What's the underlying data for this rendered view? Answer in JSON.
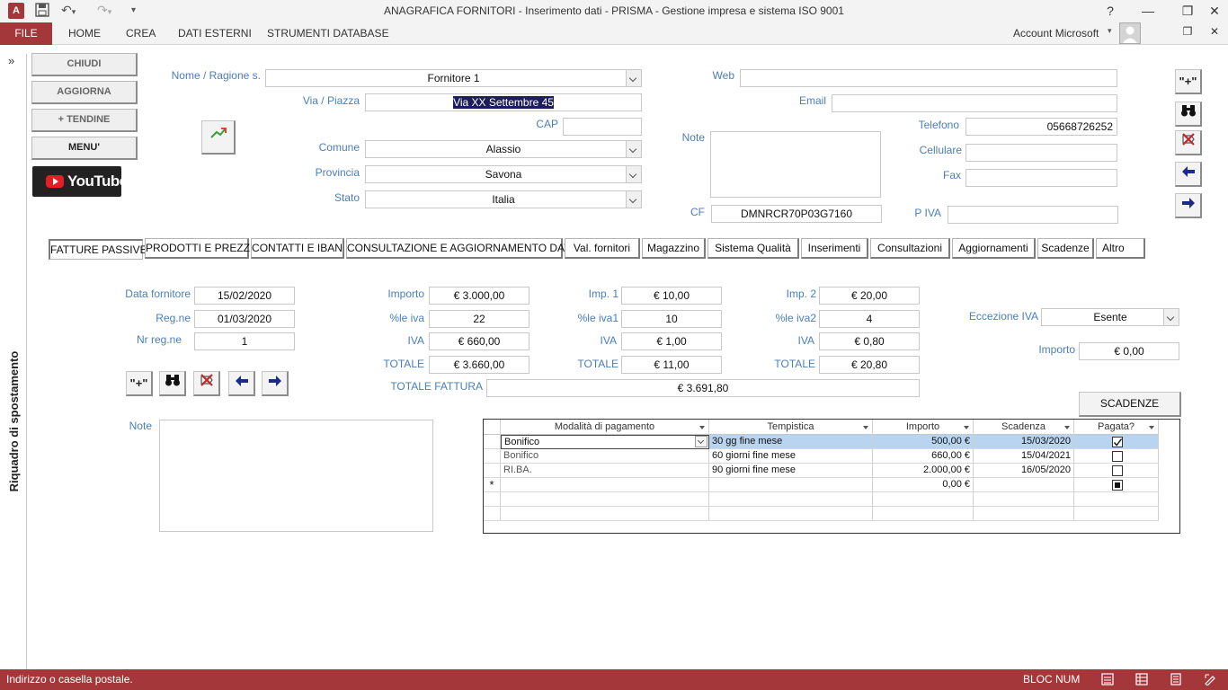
{
  "window": {
    "title": "ANAGRAFICA FORNITORI - Inserimento dati - PRISMA - Gestione impresa e sistema ISO 9001",
    "help": "?",
    "account": "Account Microsoft"
  },
  "ribbon": {
    "tabs": [
      "FILE",
      "HOME",
      "CREA",
      "DATI ESTERNI",
      "STRUMENTI DATABASE"
    ]
  },
  "navpane": {
    "title": "Riquadro di spostamento",
    "toggle": "»"
  },
  "left_buttons": {
    "chiudi": "CHIUDI",
    "aggiorna": "AGGIORNA",
    "tendine": "+ TENDINE",
    "menu": "MENU'",
    "youtube": "YouTube"
  },
  "header": {
    "nome_label": "Nome / Ragione s.",
    "nome": "Fornitore 1",
    "via_label": "Via / Piazza",
    "via": "Via XX Settembre 45",
    "cap_label": "CAP",
    "cap": "",
    "comune_label": "Comune",
    "comune": "Alassio",
    "provincia_label": "Provincia",
    "provincia": "Savona",
    "stato_label": "Stato",
    "stato": "Italia",
    "note_label": "Note",
    "note": "",
    "cf_label": "CF",
    "cf": "DMNRCR70P03G7160",
    "web_label": "Web",
    "web": "",
    "email_label": "Email",
    "email": "",
    "telefono_label": "Telefono",
    "telefono": "05668726252",
    "cellulare_label": "Cellulare",
    "cellulare": "",
    "fax_label": "Fax",
    "fax": "",
    "piva_label": "P IVA",
    "piva": ""
  },
  "tabs": [
    "FATTURE PASSIVE",
    "PRODOTTI E PREZZI",
    "CONTATTI E IBAN",
    "CONSULTAZIONE E AGGIORNAMENTO DATI",
    "Val. fornitori",
    "Magazzino",
    "Sistema Qualità",
    "Inserimenti",
    "Consultazioni",
    "Aggiornamenti",
    "Scadenze",
    "Altro"
  ],
  "invoice": {
    "data_fornitore_label": "Data fornitore",
    "data_fornitore": "15/02/2020",
    "regne_label": "Reg.ne",
    "regne": "01/03/2020",
    "nr_regne_label": "Nr reg.ne",
    "nr_regne": "1",
    "importo_label": "Importo",
    "importo": "€ 3.000,00",
    "perc_iva_label": "%le iva",
    "perc_iva": "22",
    "iva_label": "IVA",
    "iva": "€ 660,00",
    "totale_label": "TOTALE",
    "totale": "€ 3.660,00",
    "imp1_label": "Imp. 1",
    "imp1": "€ 10,00",
    "perc_iva1_label": "%le iva1",
    "perc_iva1": "10",
    "iva1_label": "IVA",
    "iva1": "€ 1,00",
    "totale1_label": "TOTALE",
    "totale1": "€ 11,00",
    "imp2_label": "Imp. 2",
    "imp2": "€ 20,00",
    "perc_iva2_label": "%le iva2",
    "perc_iva2": "4",
    "iva2_label": "IVA",
    "iva2": "€ 0,80",
    "totale2_label": "TOTALE",
    "totale2": "€ 20,80",
    "eccezione_label": "Eccezione IVA",
    "eccezione": "Esente",
    "importo_ecc_label": "Importo",
    "importo_ecc": "€ 0,00",
    "totale_fattura_label": "TOTALE FATTURA",
    "totale_fattura": "€ 3.691,80",
    "note_label": "Note",
    "note": "",
    "scadenze_button": "SCADENZE"
  },
  "grid": {
    "headers": [
      "Modalità di pagamento",
      "Tempistica",
      "Importo",
      "Scadenza",
      "Pagata?"
    ],
    "rows": [
      {
        "modalita": "Bonifico",
        "tempistica": "30 gg fine mese",
        "importo": "500,00 €",
        "scadenza": "15/03/2020",
        "pagata": true
      },
      {
        "modalita": "Bonifico",
        "tempistica": "60 giorni fine mese",
        "importo": "660,00 €",
        "scadenza": "15/04/2021",
        "pagata": false
      },
      {
        "modalita": "RI.BA.",
        "tempistica": "90 giorni fine mese",
        "importo": "2.000,00 €",
        "scadenza": "16/05/2020",
        "pagata": false
      }
    ],
    "new_row": {
      "marker": "*",
      "importo": "0,00 €"
    }
  },
  "statusbar": {
    "left": "Indirizzo o casella postale.",
    "right": "BLOC NUM"
  },
  "colors": {
    "accent": "#a4373a",
    "label": "#4a7ebb",
    "selected_row": "#b8d4f0"
  }
}
